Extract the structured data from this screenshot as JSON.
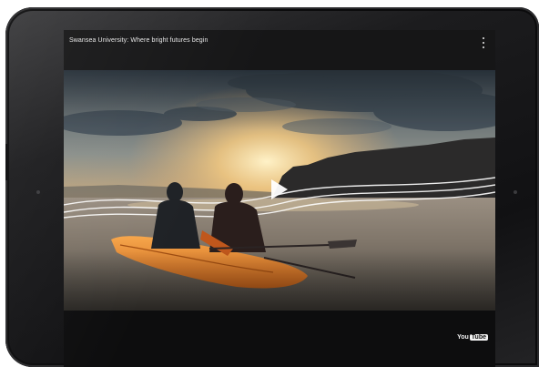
{
  "player": {
    "video_title": "Swansea University: Where bright futures begin",
    "menu_icon": "more-vert-icon",
    "play_icon": "play-icon",
    "brand": {
      "logo_prefix": "You",
      "logo_suffix": "Tube"
    }
  },
  "colors": {
    "bezel": "#1c1c1e",
    "screen": "#0d0d0e",
    "title_bar": "#161617",
    "title_text": "#e6e6e6",
    "kayak": "#f0902a"
  }
}
